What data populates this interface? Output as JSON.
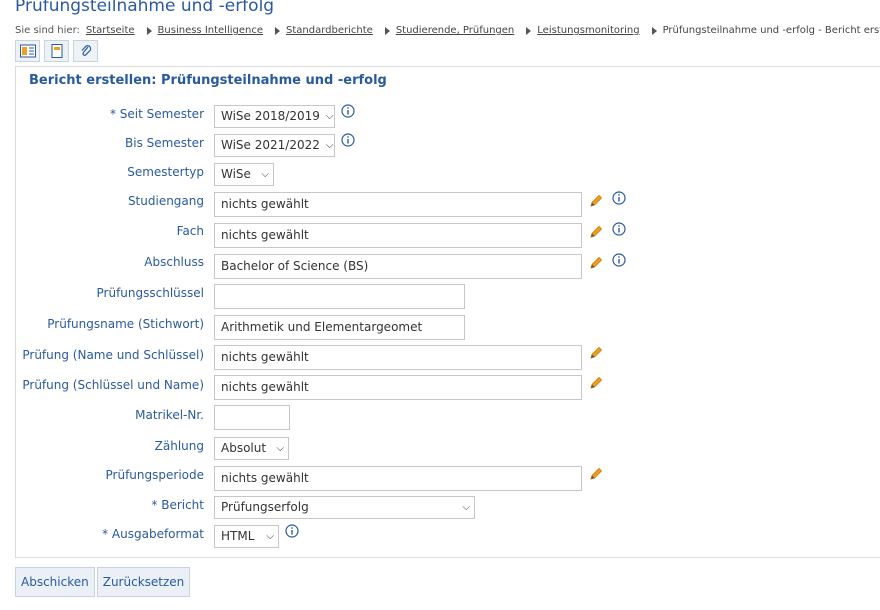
{
  "page": {
    "title": "Prüfungsteilnahme und -erfolg"
  },
  "breadcrumb": {
    "prefix": "Sie sind hier:",
    "items": [
      {
        "label": "Startseite"
      },
      {
        "label": "Business Intelligence"
      },
      {
        "label": "Standardberichte"
      },
      {
        "label": "Studierende, Prüfungen"
      },
      {
        "label": "Leistungsmonitoring"
      }
    ],
    "current": "Prüfungsteilnahme und -erfolg - Bericht erstellen"
  },
  "form": {
    "title": "Bericht erstellen: Prüfungsteilnahme und -erfolg",
    "fields": {
      "seit_semester": {
        "label": "* Seit Semester",
        "value": "WiSe 2018/2019"
      },
      "bis_semester": {
        "label": "Bis Semester",
        "value": "WiSe 2021/2022"
      },
      "semestertyp": {
        "label": "Semestertyp",
        "value": "WiSe"
      },
      "studiengang": {
        "label": "Studiengang",
        "value": "nichts gewählt"
      },
      "fach": {
        "label": "Fach",
        "value": "nichts gewählt"
      },
      "abschluss": {
        "label": "Abschluss",
        "value": "Bachelor of Science (BS)"
      },
      "pruefungsschluessel": {
        "label": "Prüfungsschlüssel",
        "value": ""
      },
      "pruefungsname": {
        "label": "Prüfungsname (Stichwort)",
        "value": "Arithmetik und Elementargeomet"
      },
      "pruefung_name_schluessel": {
        "label": "Prüfung (Name und Schlüssel)",
        "value": "nichts gewählt"
      },
      "pruefung_schluessel_name": {
        "label": "Prüfung (Schlüssel und Name)",
        "value": "nichts gewählt"
      },
      "matrikel": {
        "label": "Matrikel-Nr.",
        "value": ""
      },
      "zaehlung": {
        "label": "Zählung",
        "value": "Absolut"
      },
      "pruefungsperiode": {
        "label": "Prüfungsperiode",
        "value": "nichts gewählt"
      },
      "bericht": {
        "label": "* Bericht",
        "value": "Prüfungserfolg"
      },
      "ausgabeformat": {
        "label": "* Ausgabeformat",
        "value": "HTML"
      }
    }
  },
  "buttons": {
    "submit": "Abschicken",
    "reset": "Zurücksetzen"
  },
  "icons": {
    "toolbar": [
      "report-export-icon",
      "bookmark-icon",
      "attachment-icon"
    ],
    "edit": "pencil-icon",
    "info": "info-icon"
  },
  "colors": {
    "accent": "#2a5a9e",
    "edit": "#f0a020"
  }
}
